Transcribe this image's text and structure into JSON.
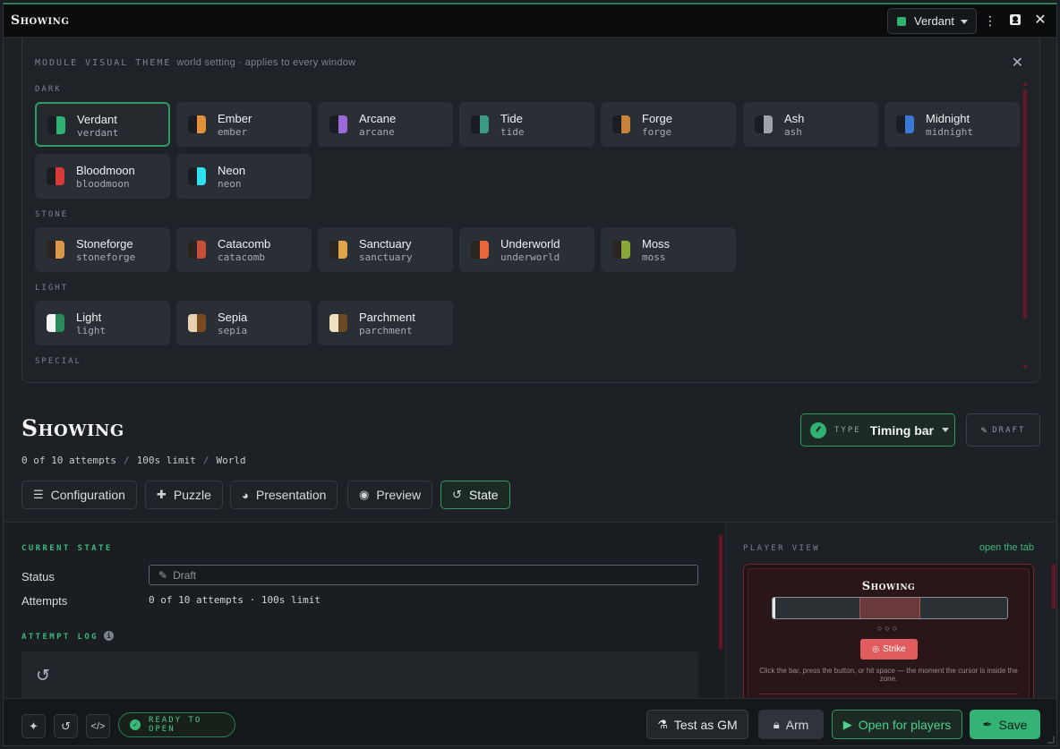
{
  "window": {
    "title": "Showing"
  },
  "titlebar": {
    "theme_select": {
      "value": "Verdant",
      "color": "#2fb171"
    },
    "icons": [
      "more-vertical-icon",
      "module-badge-icon",
      "close-icon"
    ]
  },
  "theme_panel": {
    "heading": "MODULE VISUAL THEME",
    "subheading": "world setting · applies to every window",
    "groups": [
      {
        "label": "DARK",
        "themes": [
          {
            "name": "Verdant",
            "id": "verdant",
            "swatch": [
              "#1a1d21",
              "#2fb171"
            ],
            "selected": true
          },
          {
            "name": "Ember",
            "id": "ember",
            "swatch": [
              "#1a1d21",
              "#e0913a"
            ]
          },
          {
            "name": "Arcane",
            "id": "arcane",
            "swatch": [
              "#1a1d21",
              "#9a6ad8"
            ]
          },
          {
            "name": "Tide",
            "id": "tide",
            "swatch": [
              "#1a1d21",
              "#3a9a82"
            ]
          },
          {
            "name": "Forge",
            "id": "forge",
            "swatch": [
              "#1a1d21",
              "#c8823a"
            ]
          },
          {
            "name": "Ash",
            "id": "ash",
            "swatch": [
              "#1a1d21",
              "#9ea4aa"
            ]
          },
          {
            "name": "Midnight",
            "id": "midnight",
            "swatch": [
              "#1a1d21",
              "#3a78d8"
            ]
          },
          {
            "name": "Bloodmoon",
            "id": "bloodmoon",
            "swatch": [
              "#1a1d21",
              "#d83a3a"
            ]
          },
          {
            "name": "Neon",
            "id": "neon",
            "swatch": [
              "#1a1d21",
              "#2ee0f0"
            ]
          }
        ]
      },
      {
        "label": "STONE",
        "themes": [
          {
            "name": "Stoneforge",
            "id": "stoneforge",
            "swatch": [
              "#2a2520",
              "#d89a4a"
            ]
          },
          {
            "name": "Catacomb",
            "id": "catacomb",
            "swatch": [
              "#2a2520",
              "#c8503a"
            ]
          },
          {
            "name": "Sanctuary",
            "id": "sanctuary",
            "swatch": [
              "#2a2520",
              "#e0a44a"
            ]
          },
          {
            "name": "Underworld",
            "id": "underworld",
            "swatch": [
              "#2a2520",
              "#e8663a"
            ]
          },
          {
            "name": "Moss",
            "id": "moss",
            "swatch": [
              "#2a2520",
              "#8aa83a"
            ]
          }
        ]
      },
      {
        "label": "LIGHT",
        "themes": [
          {
            "name": "Light",
            "id": "light",
            "swatch": [
              "#f4f4f4",
              "#2a8a5a"
            ]
          },
          {
            "name": "Sepia",
            "id": "sepia",
            "swatch": [
              "#e8d2b0",
              "#7a4a22"
            ]
          },
          {
            "name": "Parchment",
            "id": "parchment",
            "swatch": [
              "#f0e2c0",
              "#6a4a22"
            ]
          }
        ]
      },
      {
        "label": "SPECIAL",
        "themes": []
      }
    ]
  },
  "header": {
    "title": "Showing",
    "meta": [
      "0 of 10 attempts",
      "100s limit",
      "World"
    ],
    "type_label": "TYPE",
    "type_value": "Timing bar",
    "draft_label": "DRAFT"
  },
  "tabs": [
    {
      "label": "Configuration",
      "icon": "sliders-icon"
    },
    {
      "label": "Puzzle",
      "icon": "puzzle-icon"
    },
    {
      "label": "Presentation",
      "icon": "palette-icon"
    },
    {
      "label": "Preview",
      "icon": "eye-icon"
    },
    {
      "label": "State",
      "icon": "history-icon",
      "active": true
    }
  ],
  "state": {
    "section_current": "CURRENT STATE",
    "status_label": "Status",
    "status_value": "Draft",
    "attempts_label": "Attempts",
    "attempts_value": "0 of 10 attempts · 100s limit",
    "section_log": "ATTEMPT LOG"
  },
  "player_view": {
    "label": "PLAYER VIEW",
    "link": "open the tab",
    "title": "Showing",
    "zone_start": 0.37,
    "zone_end": 0.63,
    "dots": "○○○",
    "strike_label": "Strike",
    "help": "Click the bar, press the button, or hit space — the moment the cursor is inside the zone."
  },
  "footer": {
    "ready_label": "READY TO OPEN",
    "test_label": "Test as GM",
    "arm_label": "Arm",
    "open_label": "Open for players",
    "save_label": "Save"
  }
}
